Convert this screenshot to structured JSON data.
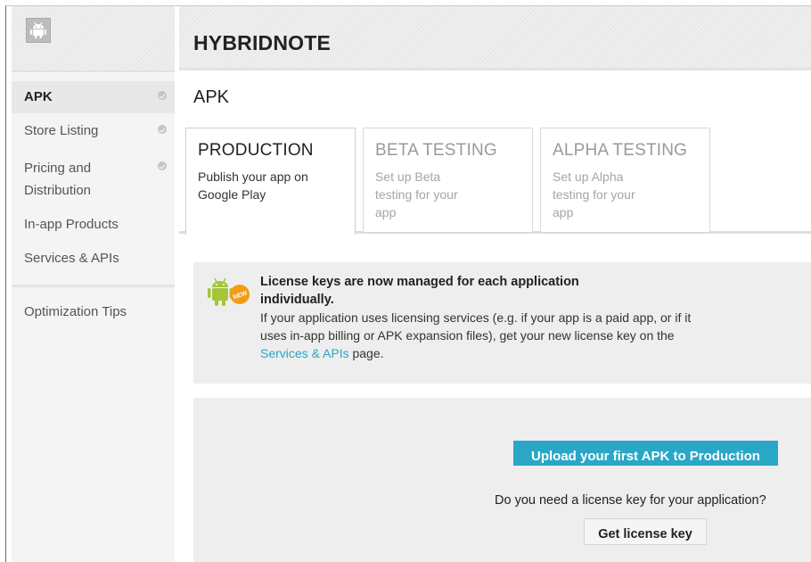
{
  "app": {
    "title": "HYBRIDNOTE",
    "icon": "android-icon"
  },
  "sidebar": {
    "items": [
      {
        "label": "APK",
        "active": true,
        "checked": true
      },
      {
        "label": "Store Listing",
        "active": false,
        "checked": true
      },
      {
        "label": "Pricing and Distribution",
        "active": false,
        "checked": true
      },
      {
        "label": "In-app Products",
        "active": false,
        "checked": false
      },
      {
        "label": "Services & APIs",
        "active": false,
        "checked": false
      },
      {
        "label": "Optimization Tips",
        "active": false,
        "checked": false
      }
    ]
  },
  "main": {
    "page_title": "APK",
    "tabs": [
      {
        "title": "PRODUCTION",
        "desc": "Publish your app on Google Play",
        "active": true
      },
      {
        "title": "BETA TESTING",
        "desc": "Set up Beta testing for your app",
        "active": false
      },
      {
        "title": "ALPHA TESTING",
        "desc": "Set up Alpha testing for your app",
        "active": false
      }
    ],
    "notice": {
      "icon": "android-new-icon",
      "badge": "NEW",
      "title": "License keys are now managed for each application individually.",
      "body_before": "If your application uses licensing services (e.g. if your app is a paid app, or if it uses in-app billing or APK expansion files), get your new license key on the",
      "link": "Services & APIs",
      "body_after": "page."
    },
    "upload": {
      "button": "Upload your first APK to Production",
      "question": "Do you need a license key for your application?",
      "license_button": "Get license key"
    }
  },
  "colors": {
    "accent": "#2aa7c6",
    "android_green": "#a4c639",
    "badge_orange": "#f39c12"
  }
}
